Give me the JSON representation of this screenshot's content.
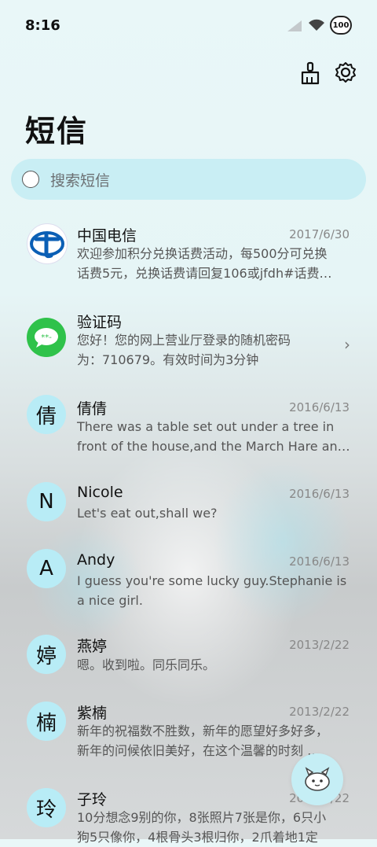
{
  "status": {
    "time": "8:16",
    "battery": "100"
  },
  "header": {
    "title": "短信"
  },
  "search": {
    "placeholder": "搜索短信"
  },
  "messages": [
    {
      "avatar": "",
      "name": "中国电信",
      "date": "2017/6/30",
      "line1": "欢迎参加积分兑换话费活动，每500分可兑换",
      "line2": "话费5元，兑换话费请回复106或jfdh#话费…"
    },
    {
      "avatar": "",
      "name": "验证码",
      "date": "",
      "line1": "您好！您的网上营业厅登录的随机密码",
      "line2": "为：710679。有效时间为3分钟"
    },
    {
      "avatar": "倩",
      "name": "倩倩",
      "date": "2016/6/13",
      "line1": "There was a table set out under a tree in",
      "line2": "front of the house,and the March Hare an…"
    },
    {
      "avatar": "N",
      "name": "Nicole",
      "date": "2016/6/13",
      "line1": "Let's eat out,shall we?",
      "line2": ""
    },
    {
      "avatar": "A",
      "name": "Andy",
      "date": "2016/6/13",
      "line1": "I guess you're some lucky guy.Stephanie is",
      "line2": "a nice girl."
    },
    {
      "avatar": "婷",
      "name": "燕婷",
      "date": "2013/2/22",
      "line1": "嗯。收到啦。同乐同乐。",
      "line2": ""
    },
    {
      "avatar": "楠",
      "name": "紫楠",
      "date": "2013/2/22",
      "line1": "新年的祝福数不胜数，新年的愿望好多好多，",
      "line2": "新年的问候依旧美好，在这个温馨的时刻 …"
    },
    {
      "avatar": "玲",
      "name": "子玲",
      "date": "2013/2/22",
      "line1": "10分想念9别的你，8张照片7张是你，6只小",
      "line2": "狗5只像你，4根骨头3根归你，2爪着地1定"
    }
  ]
}
